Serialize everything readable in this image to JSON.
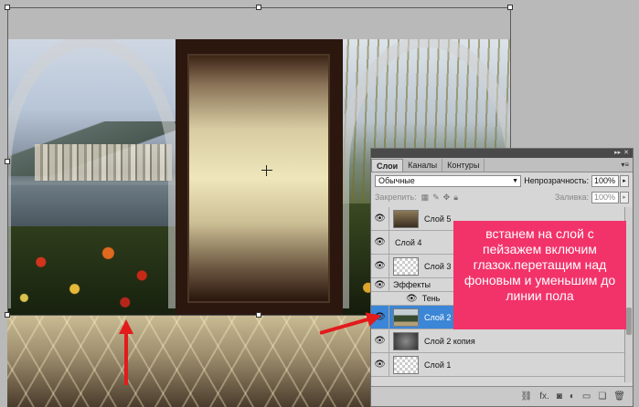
{
  "layers_panel": {
    "tabs": [
      "Слои",
      "Каналы",
      "Контуры"
    ],
    "blend_mode": "Обычные",
    "opacity_label": "Непрозрачность:",
    "opacity_value": "100%",
    "lock_label": "Закрепить:",
    "fill_label": "Заливка:",
    "fill_value": "100%",
    "layers": [
      {
        "name": "Слой 5"
      },
      {
        "name": "Слой 4"
      },
      {
        "name": "Слой 3"
      },
      {
        "name": "Эффекты"
      },
      {
        "name": "Тень"
      },
      {
        "name": "Слой 2"
      },
      {
        "name": "Слой 2 копия"
      },
      {
        "name": "Слой 1"
      }
    ]
  },
  "annotation": {
    "text": "встанем на слой с пейзажем включим глазок.перетащим над фоновым и уменьшим до линии пола",
    "color": "#f2336a"
  },
  "colors": {
    "arrow": "#e21b1b",
    "selected_layer": "#3b86d6"
  }
}
